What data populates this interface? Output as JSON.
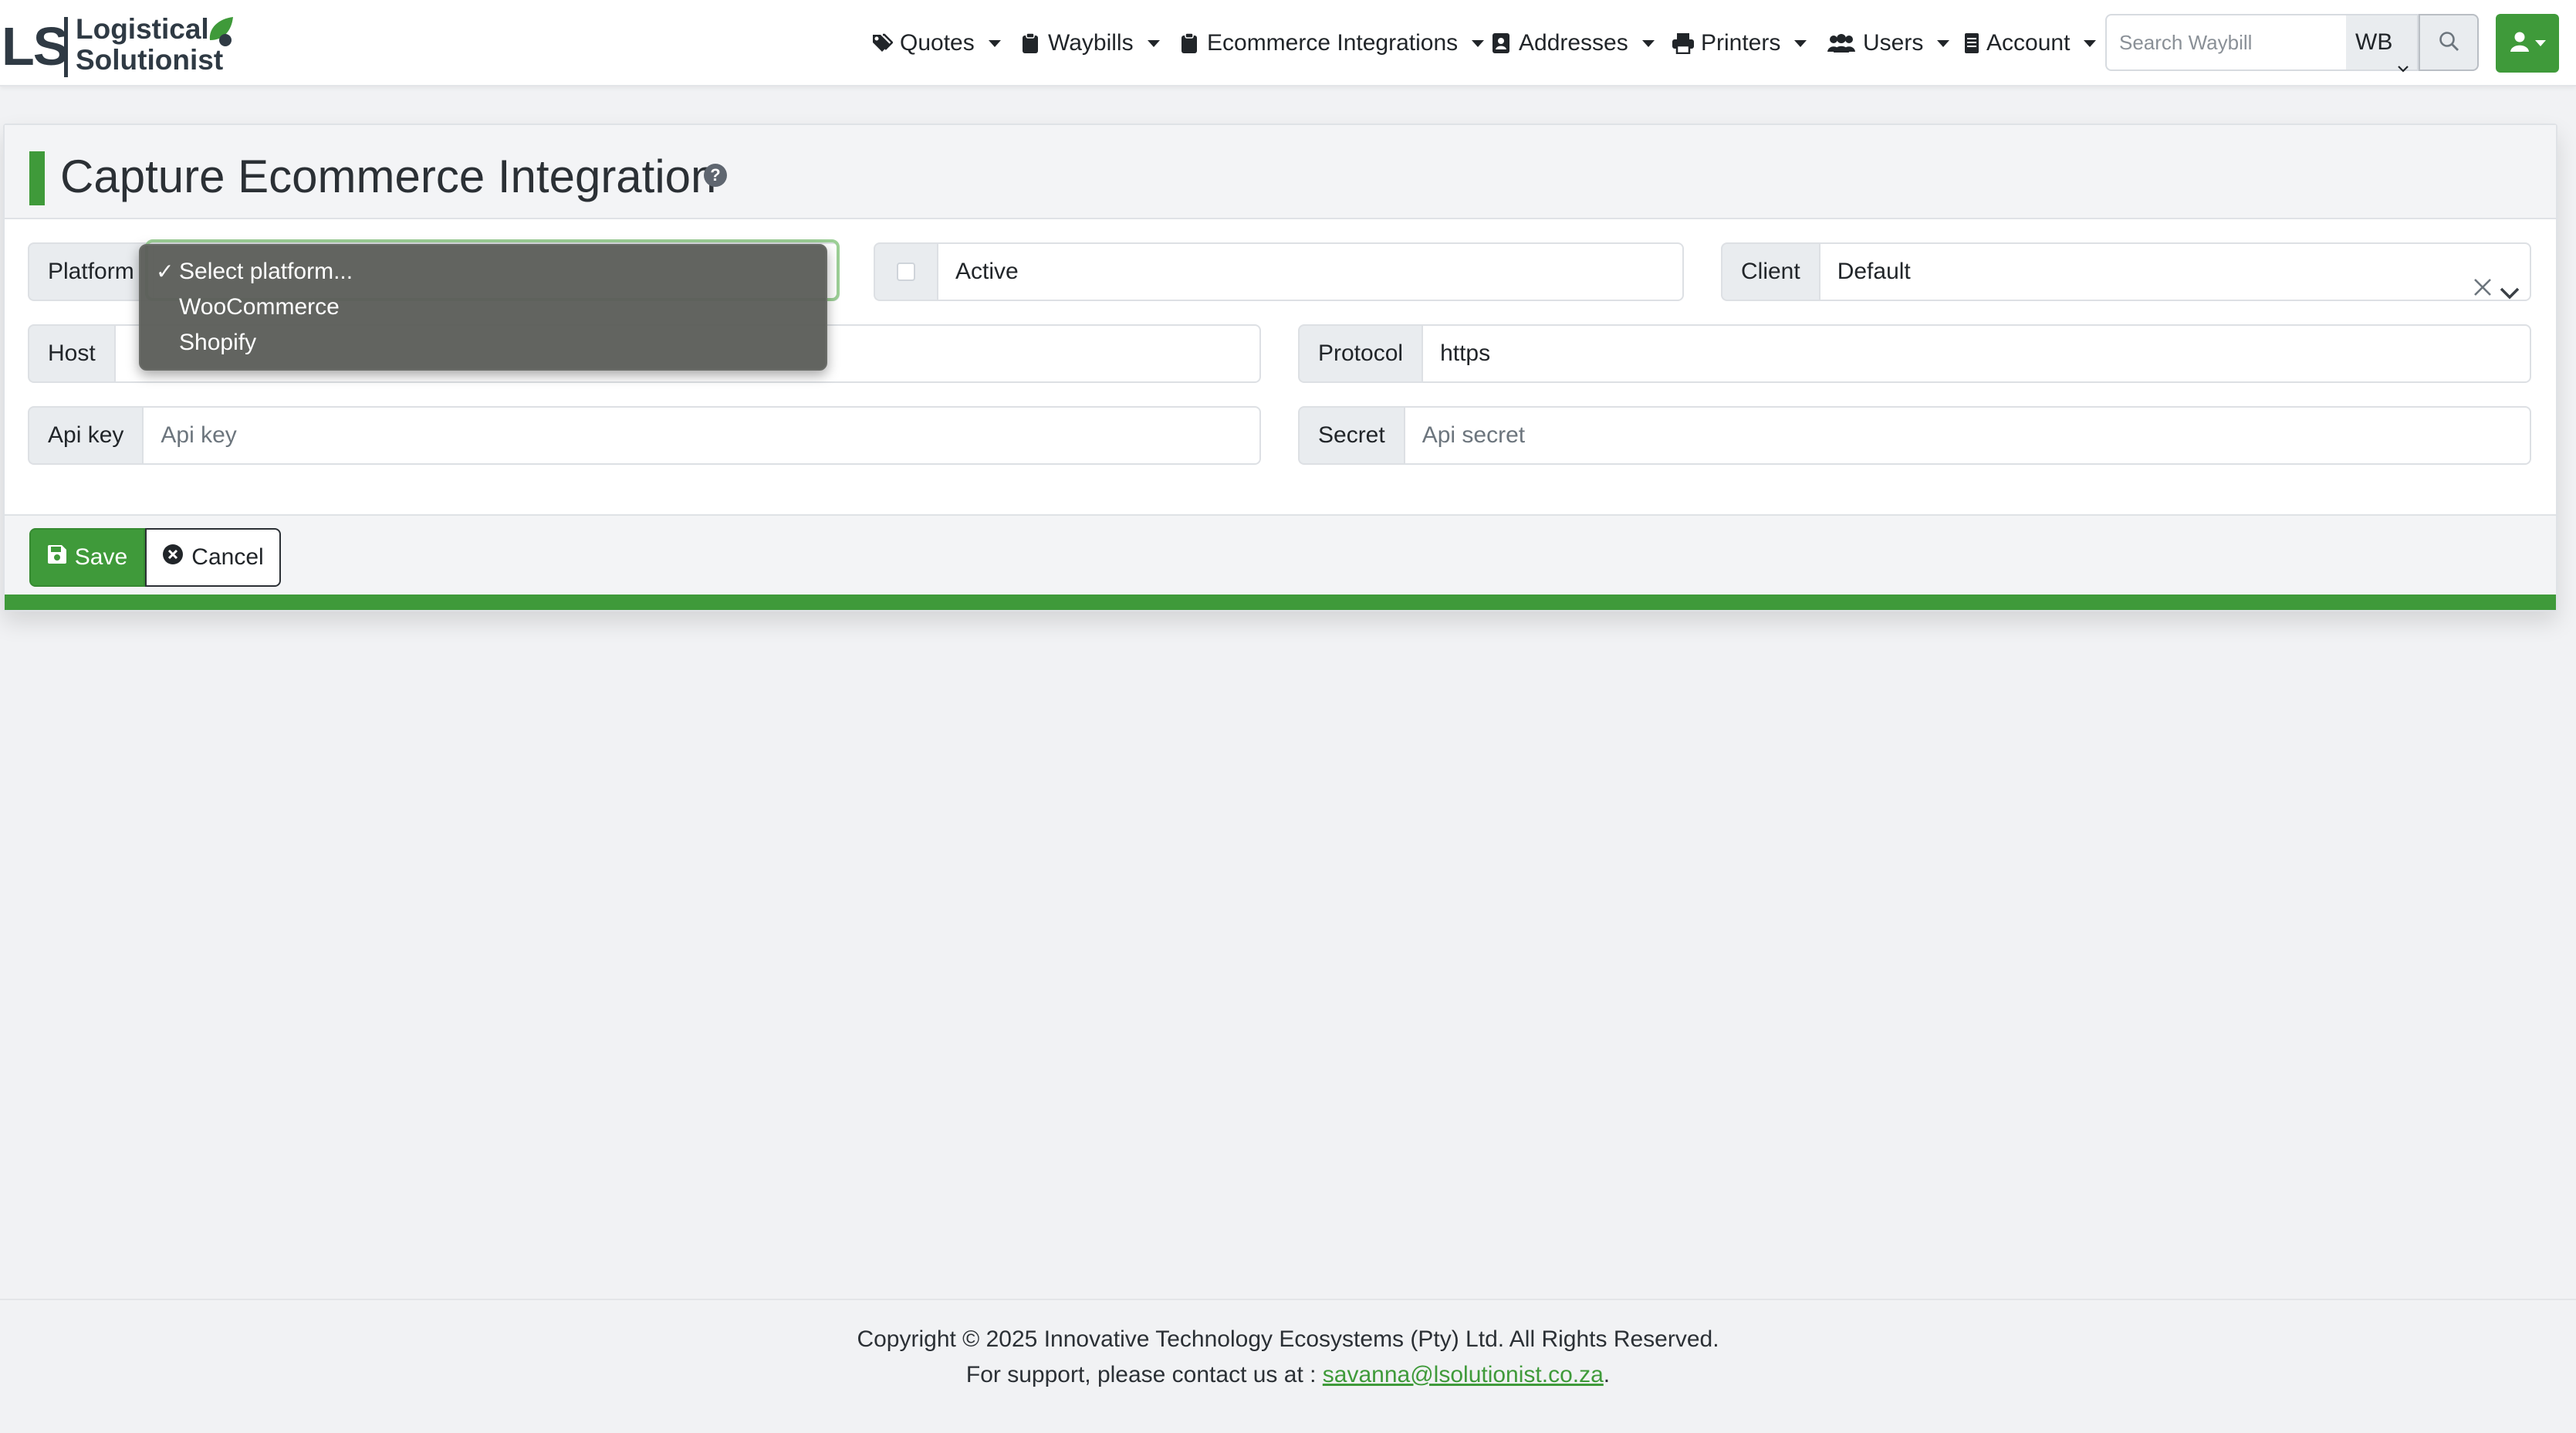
{
  "brand": {
    "initials": "LS",
    "name_line1": "Logistical",
    "name_line2": "Solutionist"
  },
  "nav": {
    "items": [
      {
        "label": "Quotes",
        "icon": "tags-icon"
      },
      {
        "label": "Waybills",
        "icon": "clipboard-icon"
      },
      {
        "label": "Ecommerce Integrations",
        "icon": "clipboard-icon"
      },
      {
        "label": "Addresses",
        "icon": "address-book-icon"
      },
      {
        "label": "Printers",
        "icon": "printer-icon"
      },
      {
        "label": "Users",
        "icon": "users-icon"
      },
      {
        "label": "Account",
        "icon": "document-icon"
      }
    ],
    "search_placeholder": "Search Waybill",
    "search_type": "WB"
  },
  "page": {
    "title": "Capture Ecommerce Integration",
    "help": "?"
  },
  "form": {
    "platform_label": "Platform",
    "platform_options": [
      "Select platform...",
      "WooCommerce",
      "Shopify"
    ],
    "platform_selected_index": 0,
    "active_label": "Active",
    "active_checked": false,
    "client_label": "Client",
    "client_value": "Default",
    "host_label": "Host",
    "protocol_label": "Protocol",
    "protocol_value": "https",
    "apikey_label": "Api key",
    "apikey_placeholder": "Api key",
    "secret_label": "Secret",
    "secret_placeholder": "Api secret"
  },
  "actions": {
    "save": "Save",
    "cancel": "Cancel"
  },
  "footer": {
    "copyright": "Copyright © 2025 Innovative Technology Ecosystems (Pty) Ltd. All Rights Reserved.",
    "support_prefix": "For support, please contact us at : ",
    "support_email": "savanna@lsolutionist.co.za",
    "support_suffix": "."
  },
  "colors": {
    "accent_green": "#3f9a3a",
    "background": "#f1f2f4",
    "dropdown_bg": "#5c5e5a"
  }
}
